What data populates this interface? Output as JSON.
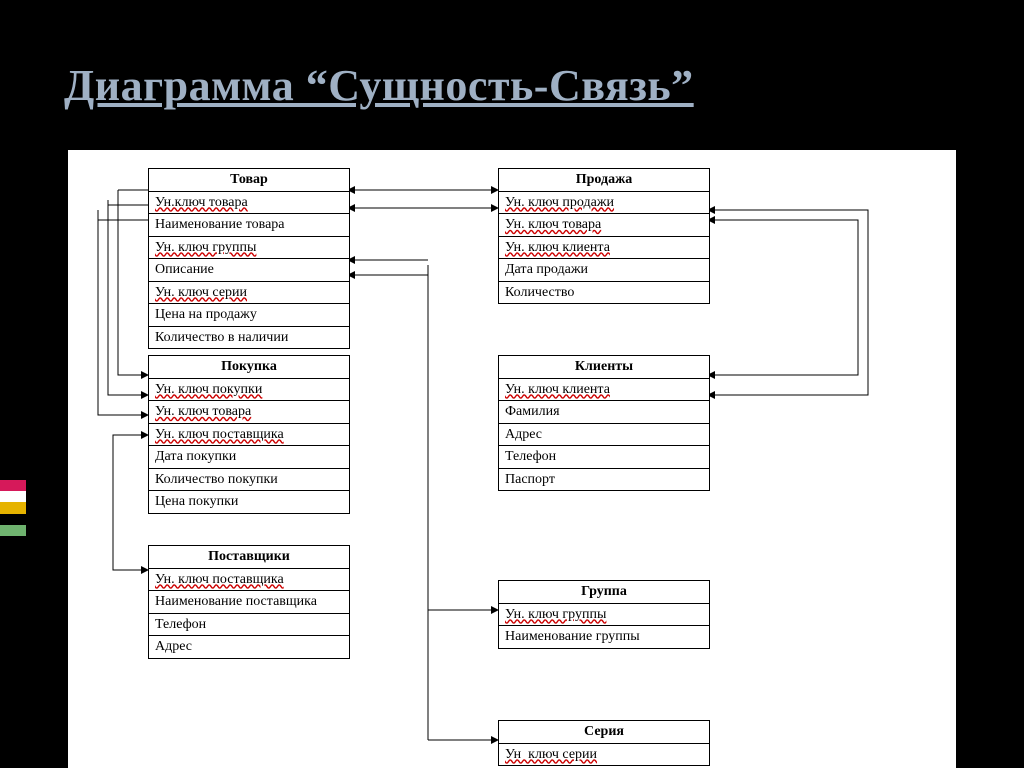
{
  "title": "Диаграмма “Сущность-Связь”",
  "accent_colors": [
    "#d6195a",
    "#ffffff",
    "#e6b300",
    "#000000",
    "#6fb36f"
  ],
  "entities": {
    "tovar": {
      "name": "Товар",
      "fields": [
        "Ун.ключ товара",
        "Наименование товара",
        "Ун. ключ группы",
        "Описание",
        "Ун. ключ серии",
        "Цена на продажу",
        "Количество в наличии"
      ]
    },
    "pokupka": {
      "name": "Покупка",
      "fields": [
        "Ун. ключ покупки",
        "Ун. ключ товара",
        "Ун. ключ поставщика",
        "Дата покупки",
        "Количество покупки",
        "Цена покупки"
      ]
    },
    "postavshiki": {
      "name": "Поставщики",
      "fields": [
        "Ун. ключ поставщика",
        "Наименование поставщика",
        "Телефон",
        "Адрес"
      ]
    },
    "prodazha": {
      "name": "Продажа",
      "fields": [
        "Ун. ключ продажи",
        "Ун. ключ товара",
        "Ун. ключ клиента",
        "Дата продажи",
        "Количество"
      ]
    },
    "klienty": {
      "name": "Клиенты",
      "fields": [
        "Ун. ключ клиента",
        "Фамилия",
        "Адрес",
        "Телефон",
        "Паспорт"
      ]
    },
    "gruppa": {
      "name": "Группа",
      "fields": [
        "Ун. ключ группы",
        "Наименование группы"
      ]
    },
    "seriya": {
      "name": "Серия",
      "fields": [
        "Ун. ключ серии"
      ]
    },
    "seriya_partial_field": "Ун  ключ серии"
  },
  "relations": [
    {
      "from": "tovar",
      "to": "prodazha"
    },
    {
      "from": "tovar",
      "to": "pokupka"
    },
    {
      "from": "tovar",
      "to": "gruppa"
    },
    {
      "from": "tovar",
      "to": "seriya"
    },
    {
      "from": "pokupka",
      "to": "postavshiki"
    },
    {
      "from": "prodazha",
      "to": "klienty"
    }
  ]
}
